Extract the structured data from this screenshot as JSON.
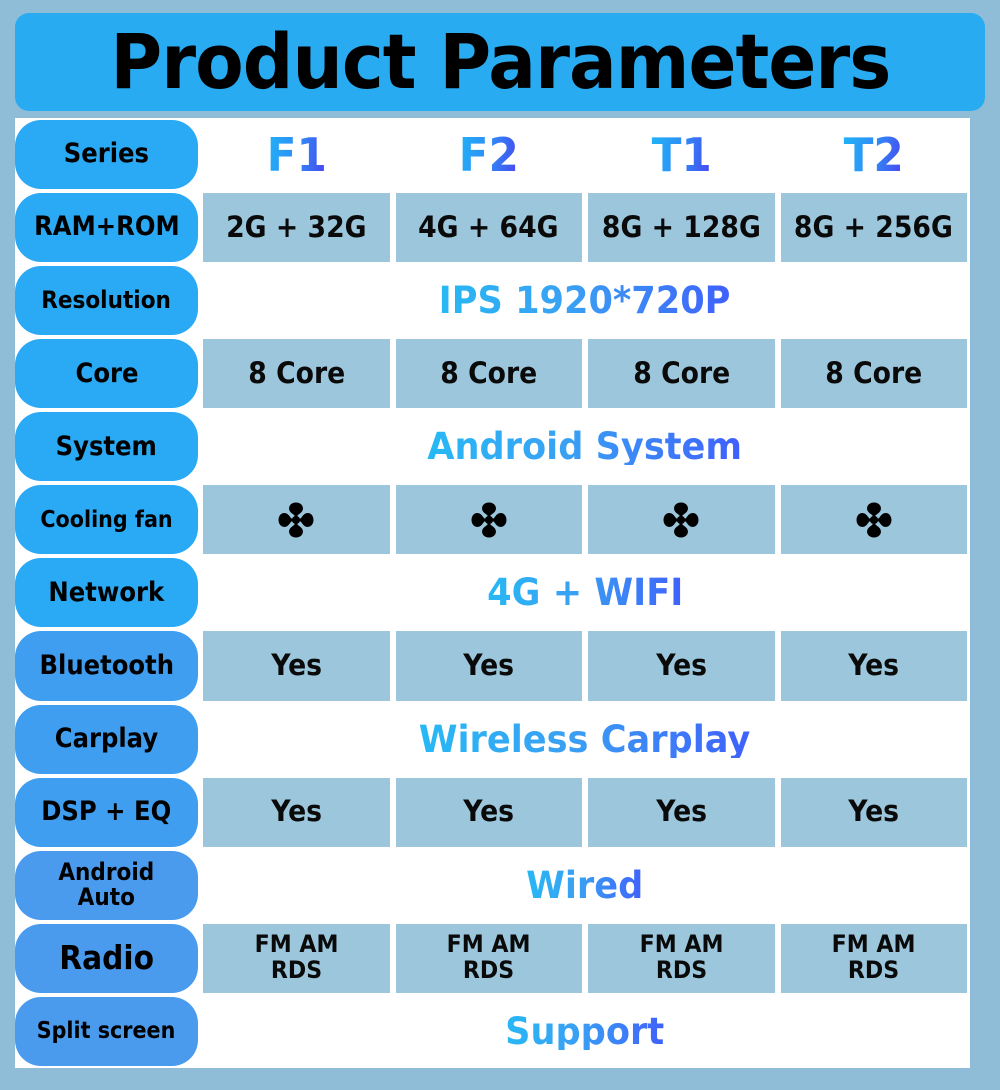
{
  "banner": {
    "title": "Product Parameters"
  },
  "colors": {
    "page_background": "#8fbdd8",
    "banner_blue": "#29abf2",
    "label_pill_blue": "#2aa9f4",
    "label_pill_blue_lower": "#4a9bee",
    "data_cell_blue": "#9bc6dc",
    "merged_row_white": "#ffffff",
    "gradient_start_cyan": "#27b9f5",
    "gradient_end_indigo": "#3f5ffc",
    "text_black": "#000000"
  },
  "table": {
    "rows": [
      {
        "label": "Series",
        "type": "series",
        "values": [
          "F1",
          "F2",
          "T1",
          "T2"
        ]
      },
      {
        "label": "RAM+ROM",
        "type": "cells",
        "values": [
          "2G + 32G",
          "4G + 64G",
          "8G + 128G",
          "8G + 256G"
        ]
      },
      {
        "label": "Resolution",
        "type": "merged",
        "merged_value": "IPS 1920*720P"
      },
      {
        "label": "Core",
        "type": "cells",
        "values": [
          "8 Core",
          "8 Core",
          "8 Core",
          "8 Core"
        ]
      },
      {
        "label": "System",
        "type": "merged",
        "merged_value": "Android  System"
      },
      {
        "label": "Cooling fan",
        "type": "icons",
        "icon": "fan-icon",
        "values": [
          "fan-icon",
          "fan-icon",
          "fan-icon",
          "fan-icon"
        ]
      },
      {
        "label": "Network",
        "type": "merged",
        "merged_value": "4G + WIFI"
      },
      {
        "label": "Bluetooth",
        "type": "cells",
        "values": [
          "Yes",
          "Yes",
          "Yes",
          "Yes"
        ]
      },
      {
        "label": "Carplay",
        "type": "merged",
        "merged_value": "Wireless Carplay"
      },
      {
        "label": "DSP + EQ",
        "type": "cells",
        "values": [
          "Yes",
          "Yes",
          "Yes",
          "Yes"
        ]
      },
      {
        "label": "Android\nAuto",
        "type": "merged",
        "merged_value": "Wired"
      },
      {
        "label": "Radio",
        "type": "cells",
        "small": true,
        "values": [
          "FM AM\nRDS",
          "FM AM\nRDS",
          "FM AM\nRDS",
          "FM AM\nRDS"
        ]
      },
      {
        "label": "Split screen",
        "type": "merged",
        "merged_value": "Support"
      }
    ]
  }
}
